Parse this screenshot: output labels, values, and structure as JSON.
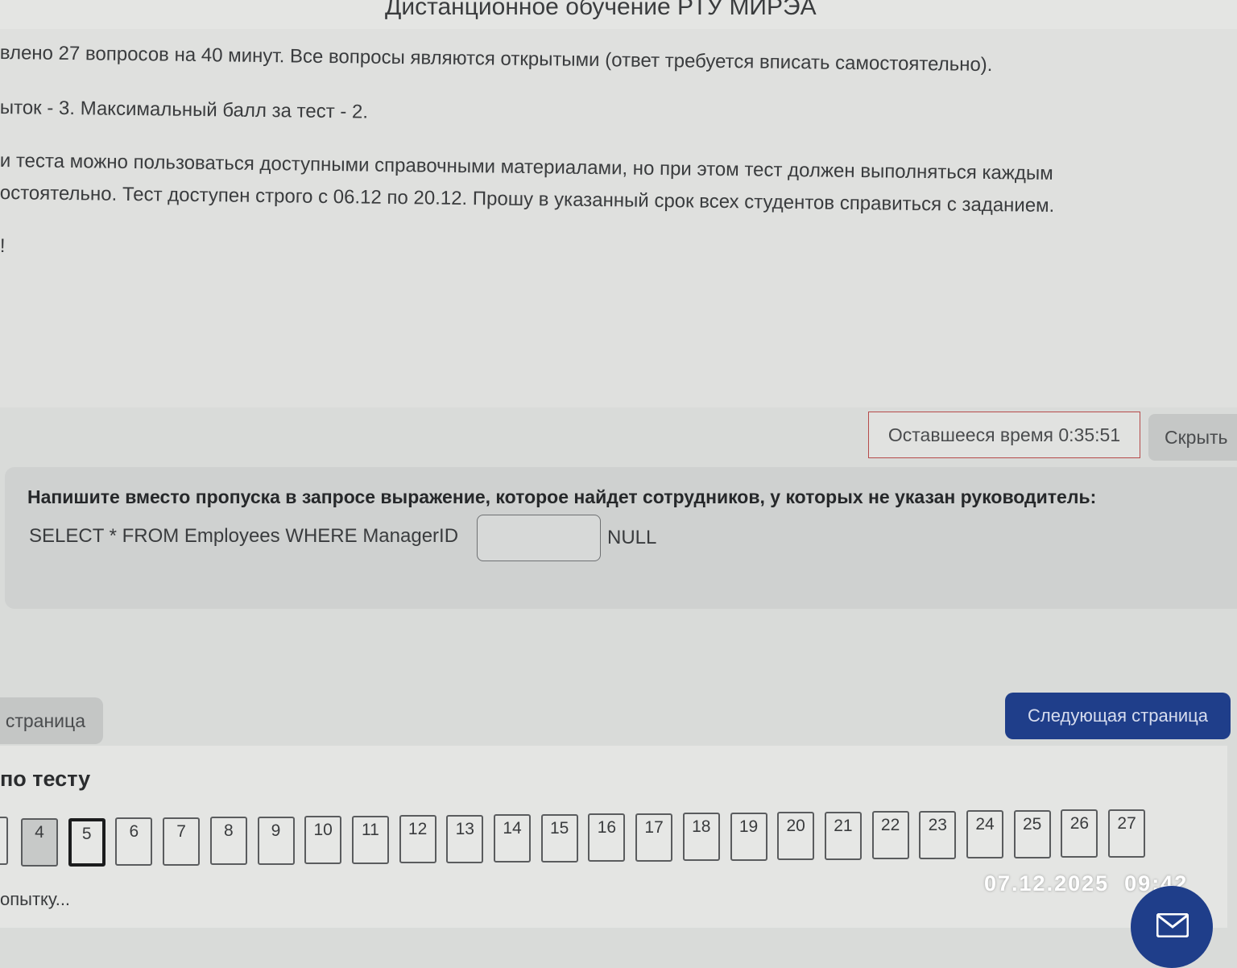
{
  "header": {
    "title": "Дистанционное обучение РТУ МИРЭА"
  },
  "intro": {
    "line1": "влено 27 вопросов на 40 минут. Все вопросы являются открытыми (ответ требуется вписать самостоятельно).",
    "line2": "ыток - 3. Максимальный балл за тест - 2.",
    "line3": "и теста можно пользоваться доступными справочными материалами, но при этом тест должен выполняться каждым",
    "line4": "остоятельно. Тест доступен строго с 06.12 по 20.12. Прошу в указанный срок всех студентов справиться с заданием.",
    "line5": "!"
  },
  "timer": {
    "text": "Оставшееся время 0:35:51",
    "hide_label": "Скрыть"
  },
  "question": {
    "title": "Напишите вместо пропуска в запросе выражение, которое найдет сотрудников, у которых не указан руководитель:",
    "sql_prefix": "SELECT * FROM Employees WHERE ManagerID",
    "answer_value": "",
    "sql_suffix": "NULL"
  },
  "navigation": {
    "prev_label": "страница",
    "next_label": "Следующая страница",
    "panel_title": "по тесту",
    "finish_label": "опытку...",
    "current_question": 5,
    "questions": [
      {
        "num": "4",
        "answered": true
      },
      {
        "num": "5",
        "answered": false
      },
      {
        "num": "6",
        "answered": false
      },
      {
        "num": "7",
        "answered": false
      },
      {
        "num": "8",
        "answered": false
      },
      {
        "num": "9",
        "answered": false
      },
      {
        "num": "10",
        "answered": false
      },
      {
        "num": "11",
        "answered": false
      },
      {
        "num": "12",
        "answered": false
      },
      {
        "num": "13",
        "answered": false
      },
      {
        "num": "14",
        "answered": false
      },
      {
        "num": "15",
        "answered": false
      },
      {
        "num": "16",
        "answered": false
      },
      {
        "num": "17",
        "answered": false
      },
      {
        "num": "18",
        "answered": false
      },
      {
        "num": "19",
        "answered": false
      },
      {
        "num": "20",
        "answered": false
      },
      {
        "num": "21",
        "answered": false
      },
      {
        "num": "22",
        "answered": false
      },
      {
        "num": "23",
        "answered": false
      },
      {
        "num": "24",
        "answered": false
      },
      {
        "num": "25",
        "answered": false
      },
      {
        "num": "26",
        "answered": false
      },
      {
        "num": "27",
        "answered": false
      }
    ]
  },
  "camera_stamp": {
    "date": "07.12.2025",
    "time": "09:42"
  },
  "fab": {
    "icon": "envelope-icon"
  },
  "colors": {
    "accent": "#1f3e8a",
    "timer_border": "#b64a4a"
  }
}
